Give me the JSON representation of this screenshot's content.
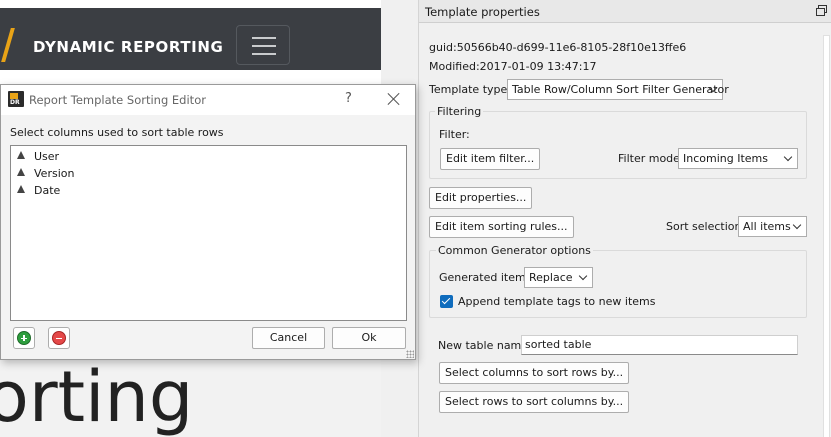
{
  "background_page": {
    "nav_title": "DYNAMIC REPORTING",
    "hero_word": "orting"
  },
  "template_properties": {
    "title": "Template properties",
    "guid": "guid:50566b40-d699-11e6-8105-28f10e13ffe6",
    "modified": "Modified:2017-01-09 13:47:17",
    "template_type_label": "Template type:",
    "template_type_value": "Table Row/Column Sort Filter Generator",
    "filtering": {
      "group_title": "Filtering",
      "filter_label": "Filter:",
      "edit_item_filter_button": "Edit item filter...",
      "filter_mode_label": "Filter mode",
      "filter_mode_value": "Incoming Items"
    },
    "edit_properties_button": "Edit properties...",
    "edit_item_sorting_rules_button": "Edit item sorting rules...",
    "sort_selection_label": "Sort selection",
    "sort_selection_value": "All items",
    "common_generator": {
      "group_title": "Common Generator options",
      "generated_items_label": "Generated items",
      "generated_items_value": "Replace",
      "append_tags_label": "Append template tags to new items",
      "append_tags_checked": true
    },
    "new_table_name_label": "New table name",
    "new_table_name_value": "sorted table",
    "select_columns_button": "Select columns to sort rows by...",
    "select_rows_button": "Select rows to sort columns by..."
  },
  "sorting_editor": {
    "title": "Report Template Sorting Editor",
    "help": "?",
    "instruction": "Select columns used to sort table rows",
    "columns": [
      {
        "label": "User",
        "direction": "ascending"
      },
      {
        "label": "Version",
        "direction": "ascending"
      },
      {
        "label": "Date",
        "direction": "ascending"
      }
    ],
    "cancel_button": "Cancel",
    "ok_button": "Ok"
  },
  "colors": {
    "accent_checkbox": "#0f6cbd",
    "nav_background": "#3b3e43",
    "brand_slash": "#e8a317",
    "add_icon": "#2e9e3e",
    "remove_icon": "#e44848"
  }
}
